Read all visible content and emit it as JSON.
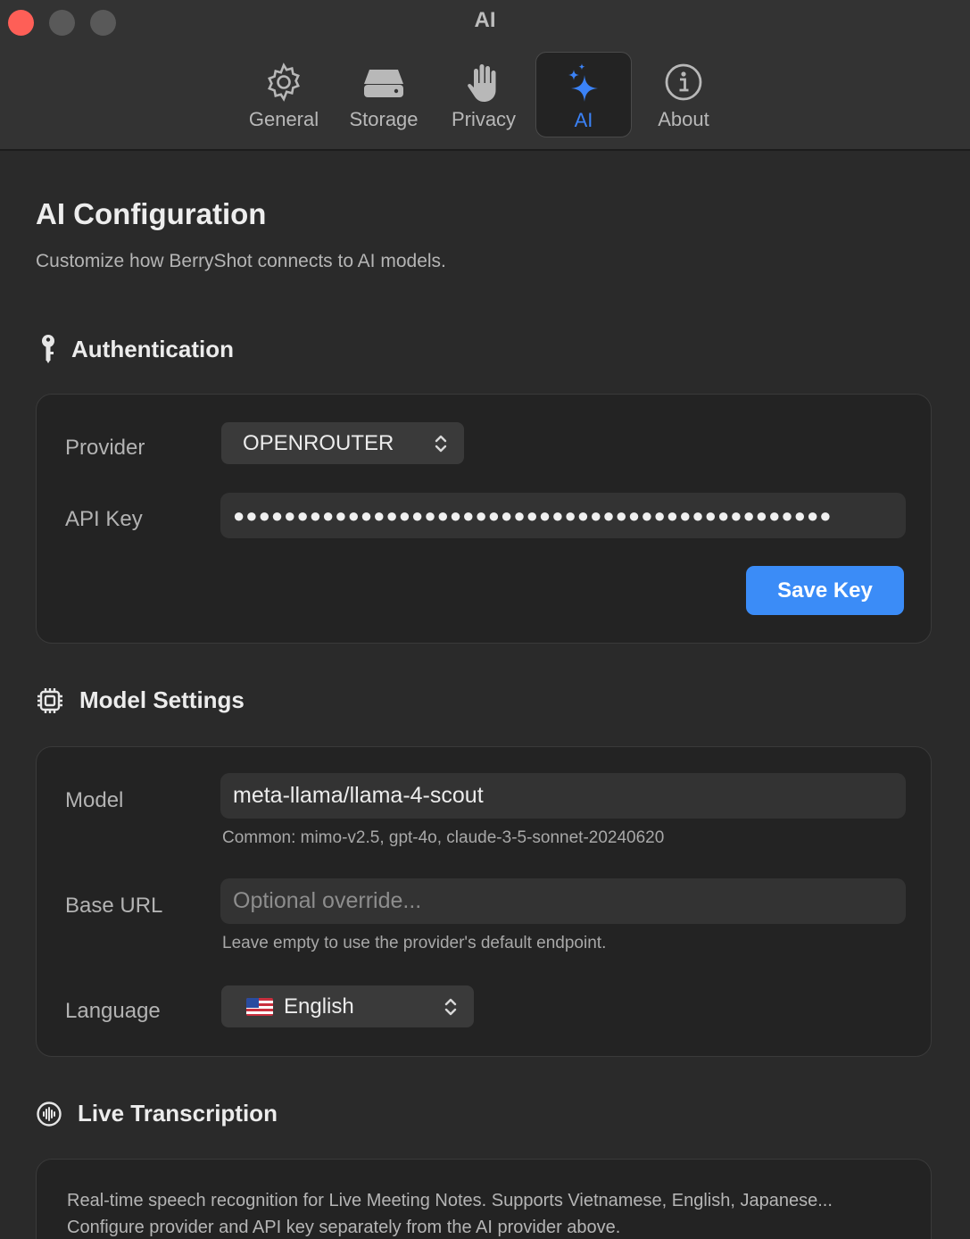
{
  "window": {
    "title": "AI"
  },
  "toolbar": {
    "tabs": [
      {
        "label": "General",
        "icon": "gear-icon"
      },
      {
        "label": "Storage",
        "icon": "drive-icon"
      },
      {
        "label": "Privacy",
        "icon": "hand-icon"
      },
      {
        "label": "AI",
        "icon": "sparkles-icon",
        "active": true
      },
      {
        "label": "About",
        "icon": "info-icon"
      }
    ]
  },
  "page": {
    "title": "AI Configuration",
    "subtitle": "Customize how BerryShot connects to AI models."
  },
  "authentication": {
    "heading": "Authentication",
    "icon": "key-icon",
    "provider_label": "Provider",
    "provider_value": "OPENROUTER",
    "api_key_label": "API Key",
    "api_key_value": "●●●●●●●●●●●●●●●●●●●●●●●●●●●●●●●●●●●●●●●●●●●●●●●",
    "save_button": "Save Key"
  },
  "model_settings": {
    "heading": "Model Settings",
    "icon": "cpu-icon",
    "model_label": "Model",
    "model_value": "meta-llama/llama-4-scout",
    "model_help": "Common: mimo-v2.5, gpt-4o, claude-3-5-sonnet-20240620",
    "base_url_label": "Base URL",
    "base_url_placeholder": "Optional override...",
    "base_url_help": "Leave empty to use the provider's default endpoint.",
    "language_label": "Language",
    "language_value": "English",
    "language_flag": "us-flag-icon"
  },
  "live_transcription": {
    "heading": "Live Transcription",
    "icon": "waveform-icon",
    "line1": "Real-time speech recognition for Live Meeting Notes. Supports Vietnamese, English, Japanese...",
    "line2": "Configure provider and API key separately from the AI provider above."
  },
  "colors": {
    "accent": "#3b82f6",
    "button": "#3b8cf7",
    "close": "#fe5f57",
    "background": "#2a2a2a",
    "card": "#232323"
  }
}
